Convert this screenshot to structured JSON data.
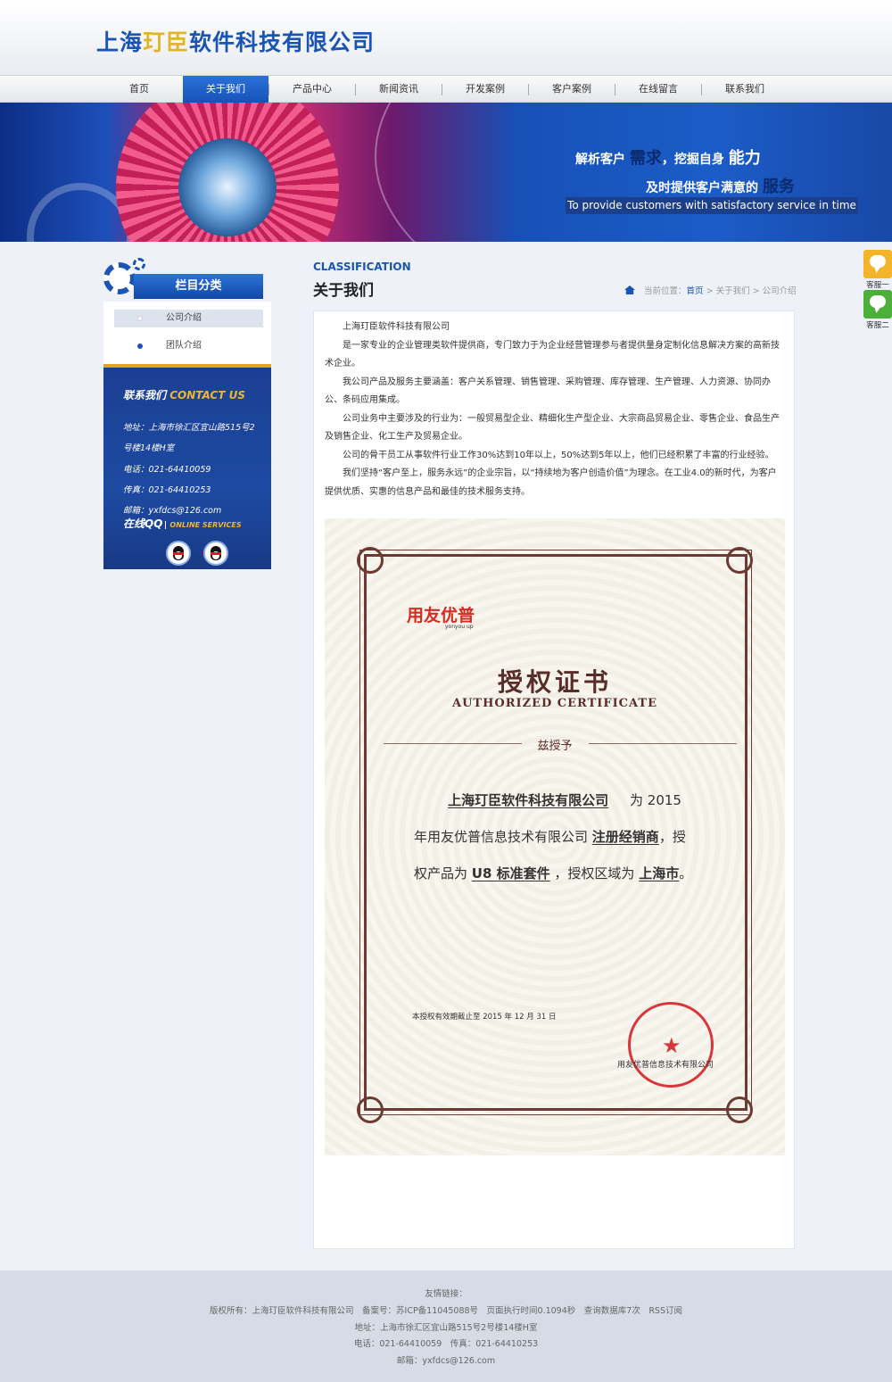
{
  "header": {
    "logo_prefix": "上海",
    "logo_highlight": "玎臣",
    "logo_suffix": "软件科技有限公司"
  },
  "nav": {
    "items": [
      "首页",
      "关于我们",
      "产品中心",
      "新闻资讯",
      "开发案例",
      "客户案例",
      "在线留言",
      "联系我们"
    ],
    "active": "关于我们"
  },
  "banner": {
    "slogan1_a": "解析客户",
    "slogan1_b": "需求",
    "slogan1_c": "，挖掘自身",
    "slogan1_d": "能力",
    "slogan2_a": "及时提供客户满意的",
    "slogan2_b": "服务",
    "slogan3": "To provide customers with satisfactory service in time"
  },
  "sidebar": {
    "category_title": "栏目分类",
    "items": [
      "公司介绍",
      "团队介绍"
    ],
    "contact_title_cn": "联系我们",
    "contact_title_en": "CONTACT US",
    "address_1": "地址：上海市徐汇区宜山路515号2",
    "address_2": "号楼14楼H室",
    "phone": "电话：021-64410059",
    "fax": "传真：021-64410253",
    "email": "邮箱：yxfdcs@126.com",
    "qq_label": "在线QQ",
    "qq_en": "ONLINE SERVICES"
  },
  "main": {
    "classification": "CLASSIFICATION",
    "title": "关于我们",
    "breadcrumb_prefix": "当前位置：",
    "breadcrumb_home": "首页",
    "breadcrumb_sep": ">",
    "breadcrumb_section": "关于我们",
    "breadcrumb_page": "公司介绍",
    "paragraphs": [
      "上海玎臣软件科技有限公司",
      "是一家专业的企业管理类软件提供商，专门致力于为企业经营管理参与者提供量身定制化信息解决方案的高新技术企业。",
      "我公司产品及服务主要涵盖：客户关系管理、销售管理、采购管理、库存管理、生产管理、人力资源、协同办公、条码应用集成。",
      "公司业务中主要涉及的行业为：一般贸易型企业、精细化生产型企业、大宗商品贸易企业、零售企业、食品生产及销售企业、化工生产及贸易企业。",
      "公司的骨干员工从事软件行业工作30%达到10年以上，50%达到5年以上，他们已经积累了丰富的行业经验。",
      "我们坚持“客户至上，服务永远”的企业宗旨，以“持续地为客户创造价值”为理念。在工业4.0的新时代，为客户提供优质、实惠的信息产品和最佳的技术服务支持。"
    ]
  },
  "certificate": {
    "brand": "用友优普",
    "brand_sub": "yonyou up",
    "title": "授权证书",
    "title_en": "AUTHORIZED CERTIFICATE",
    "grant": "兹授予",
    "company": "上海玎臣软件科技有限公司",
    "text_1": "为 2015",
    "text_2a": "年用友优普信息技术有限公司",
    "role": "注册经销商",
    "text_2b": "，授",
    "text_3a": "权产品为",
    "product": "U8 标准套件",
    "text_3b": "，授权区域为",
    "region": "上海市",
    "text_3c": "。",
    "validity": "本授权有效期截止至 2015 年 12 月 31 日",
    "issuer": "用友优普信息技术有限公司"
  },
  "float_service": [
    "客服一",
    "客服二"
  ],
  "footer": {
    "links_label": "友情链接：",
    "line1": "版权所有：上海玎臣软件科技有限公司　备案号：苏ICP备11045088号　页面执行时间0.1094秒　查询数据库7次　RSS订阅",
    "line2": "地址：上海市徐汇区宜山路515号2号楼14楼H室",
    "line3": "电话：021-64410059　传真：021-64410253",
    "line4": "邮箱：yxfdcs@126.com"
  },
  "colors": {
    "brand_blue": "#1a55b3",
    "accent_gold": "#e0b52a",
    "nav_active": "#1f62c9",
    "seal_red": "#d8363a"
  }
}
